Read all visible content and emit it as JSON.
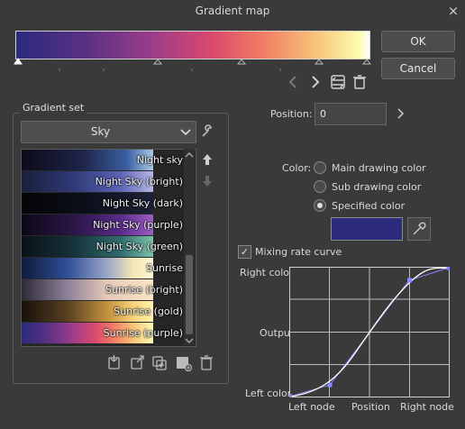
{
  "dialog": {
    "title": "Gradient map",
    "close_icon": "×"
  },
  "buttons": {
    "ok": "OK",
    "cancel": "Cancel"
  },
  "gradient_set": {
    "label": "Gradient set",
    "selected": "Sky",
    "items": [
      {
        "label": "Night sky"
      },
      {
        "label": "Night Sky (bright)"
      },
      {
        "label": "Night Sky (dark)"
      },
      {
        "label": "Night Sky (purple)"
      },
      {
        "label": "Night Sky (green)"
      },
      {
        "label": "Sunrise"
      },
      {
        "label": "Sunrise (bright)"
      },
      {
        "label": "Sunrise (gold)"
      },
      {
        "label": "Sunrise (purple)"
      }
    ]
  },
  "position": {
    "label": "Position:",
    "value": "0"
  },
  "color": {
    "label": "Color:",
    "options": [
      "Main drawing color",
      "Sub drawing color",
      "Specified color"
    ],
    "selected_index": 2,
    "swatch": "#2b2a7c"
  },
  "mixing": {
    "label": "Mixing rate curve",
    "checked": true
  },
  "curve": {
    "y_top": "Right color",
    "y_mid": "Output",
    "y_bottom": "Left color",
    "x_left": "Left node",
    "x_mid": "Position",
    "x_right": "Right node"
  },
  "colors": {
    "background": "#3a3a3a",
    "curve_node": "#8888ff"
  }
}
